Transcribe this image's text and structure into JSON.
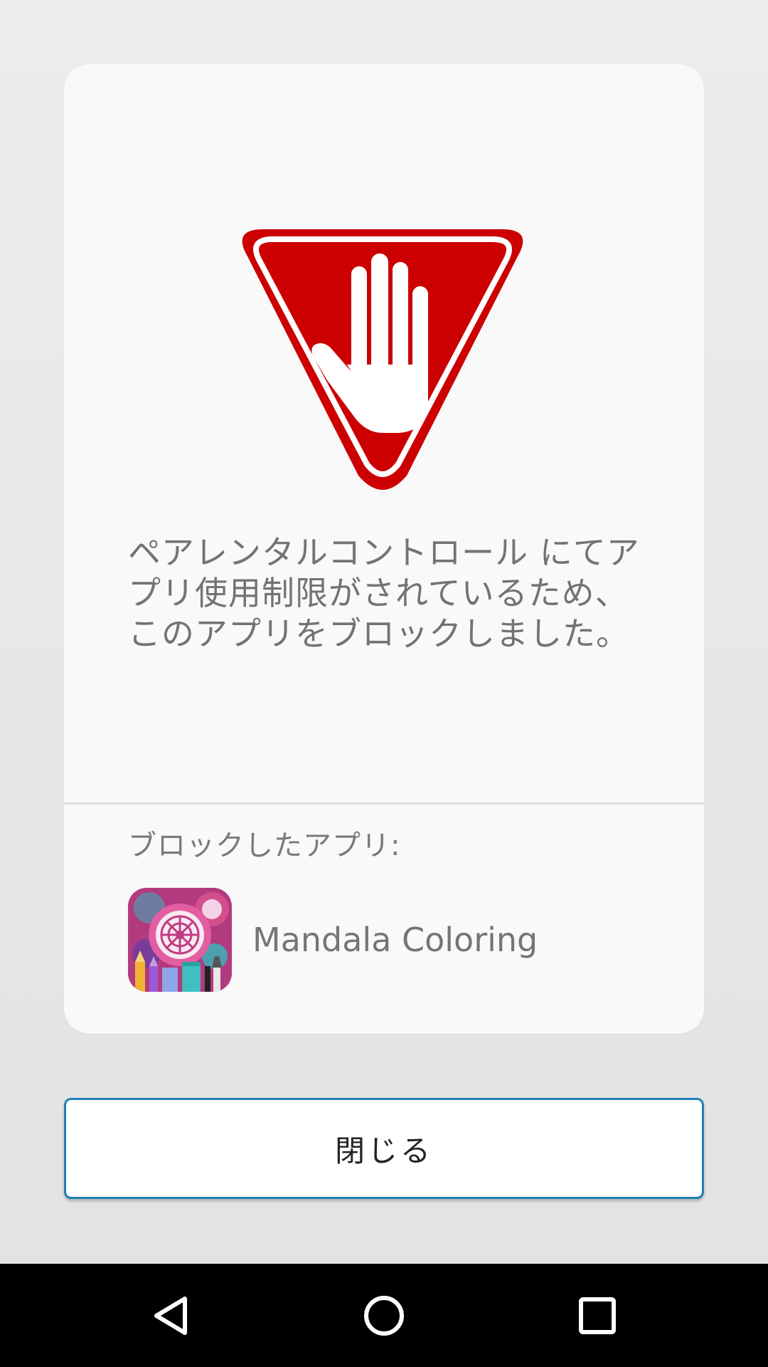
{
  "dialog": {
    "message": "ペアレンタルコントロール にてアプリ使用制限がされているため、このアプリをブロックしました。",
    "blocked_apps_label": "ブロックしたアプリ:",
    "blocked_app": {
      "name": "Mandala Coloring",
      "icon": "mandala-coloring-app-icon"
    },
    "warning_icon": "stop-hand-icon",
    "colors": {
      "warning_red": "#cc0000",
      "button_border": "#1f7fb2"
    }
  },
  "actions": {
    "close_label": "閉じる"
  },
  "navigation": {
    "back_icon": "back-triangle-icon",
    "home_icon": "home-circle-icon",
    "recents_icon": "recents-square-icon"
  }
}
